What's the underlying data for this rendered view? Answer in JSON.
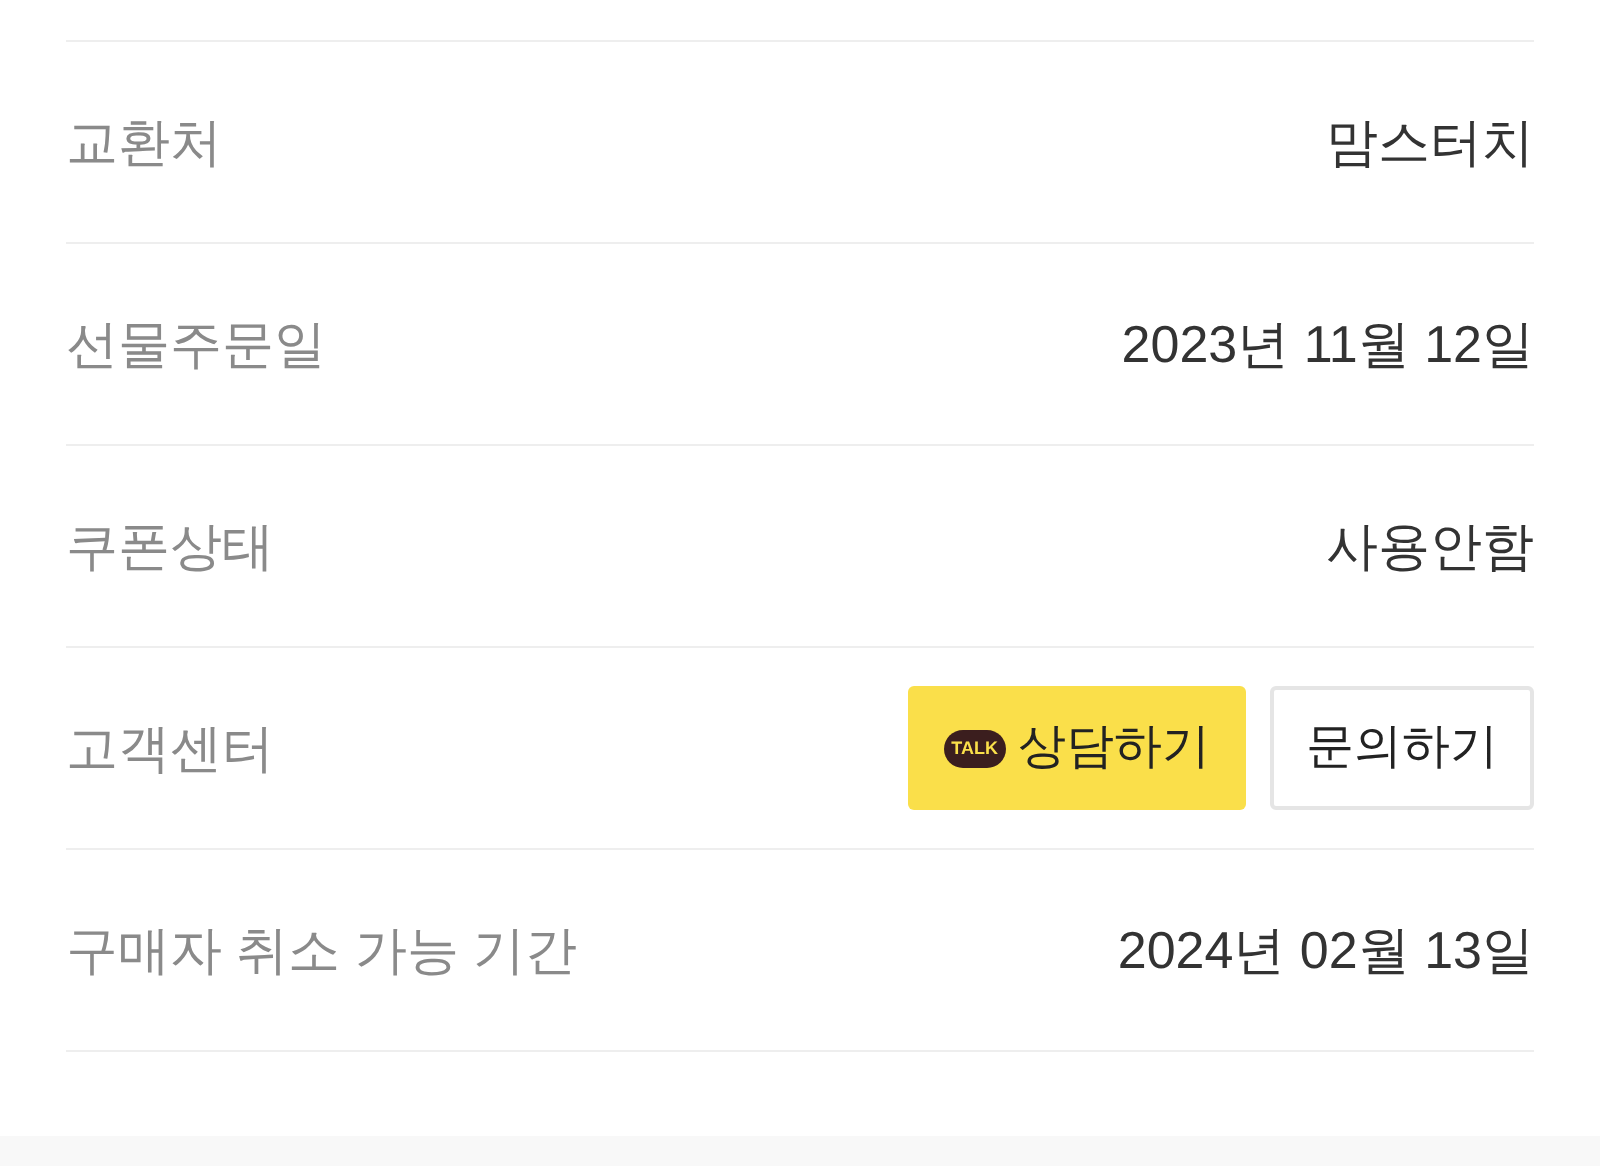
{
  "rows": [
    {
      "kind": "text",
      "label": "교환처",
      "value": "맘스터치"
    },
    {
      "kind": "text",
      "label": "선물주문일",
      "value": "2023년 11월 12일"
    },
    {
      "kind": "text",
      "label": "쿠폰상태",
      "value": "사용안함"
    },
    {
      "kind": "buttons",
      "label": "고객센터",
      "chat_button": {
        "badge": "TALK",
        "label": "상담하기"
      },
      "inquiry_button": {
        "label": "문의하기"
      }
    },
    {
      "kind": "text",
      "label": "구매자 취소 가능 기간",
      "value": "2024년 02월 13일"
    }
  ]
}
